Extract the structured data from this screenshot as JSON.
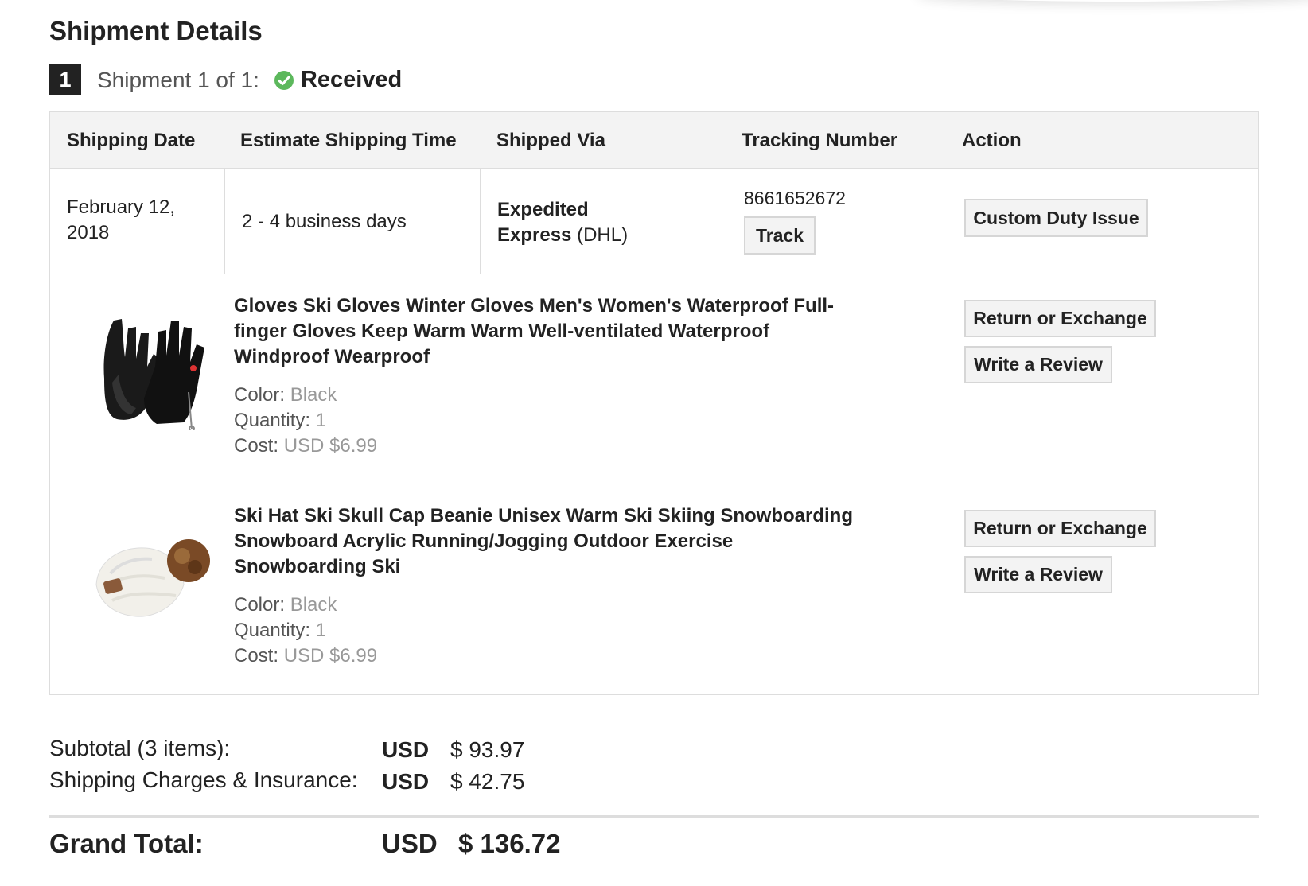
{
  "page": {
    "title": "Shipment Details"
  },
  "shipment": {
    "number": "1",
    "prefix": "Shipment 1 of 1:",
    "status": "Received",
    "status_color": "#5cb85c"
  },
  "table": {
    "headers": [
      "Shipping Date",
      "Estimate Shipping Time",
      "Shipped Via",
      "Tracking Number",
      "Action"
    ],
    "shipping_date_line1": "February 12,",
    "shipping_date_line2": "2018",
    "estimate_time": "2 - 4 business days",
    "via_bold_line1": "Expedited",
    "via_bold_line2": "Express",
    "via_suffix": " (DHL)",
    "tracking_number": "8661652672",
    "track_button": "Track",
    "custom_duty_button": "Custom Duty Issue"
  },
  "items": [
    {
      "title": "Gloves Ski Gloves Winter Gloves Men's Women's Waterproof Full-finger Gloves Keep Warm Warm Well-ventilated Waterproof Windproof Wearproof",
      "color_label": "Color:",
      "color_value": "Black",
      "quantity_label": "Quantity:",
      "quantity_value": "1",
      "cost_label": "Cost:",
      "cost_value": "USD $6.99",
      "image_icon": "gloves-image",
      "return_button": "Return or Exchange",
      "review_button": "Write a Review"
    },
    {
      "title": "Ski Hat Ski Skull Cap Beanie Unisex Warm Ski Skiing Snowboarding Snowboard Acrylic Running/Jogging Outdoor Exercise Snowboarding Ski",
      "color_label": "Color:",
      "color_value": "Black",
      "quantity_label": "Quantity:",
      "quantity_value": "1",
      "cost_label": "Cost:",
      "cost_value": "USD $6.99",
      "image_icon": "beanie-image",
      "return_button": "Return or Exchange",
      "review_button": "Write a Review"
    }
  ],
  "totals": {
    "subtotal_label": "Subtotal (3 items):",
    "subtotal_currency": "USD",
    "subtotal_value": "$ 93.97",
    "shipping_label": "Shipping Charges & Insurance:",
    "shipping_currency": "USD",
    "shipping_value": "$ 42.75",
    "grand_label": "Grand Total:",
    "grand_currency": "USD",
    "grand_value": "$ 136.72"
  }
}
